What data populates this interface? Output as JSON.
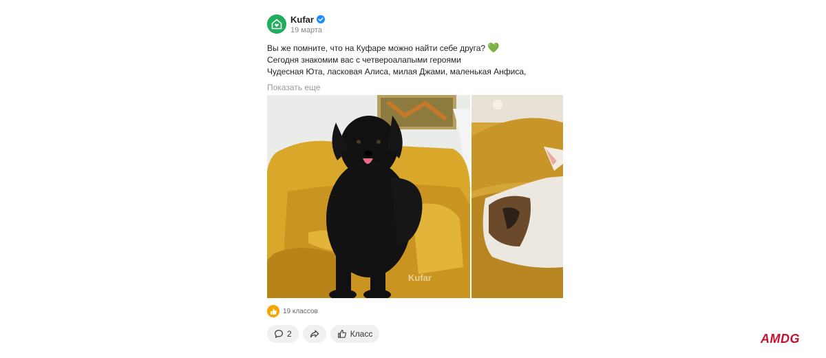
{
  "post": {
    "author": "Kufar",
    "date": "19 марта",
    "text_lines": [
      "Вы же помните, что на Куфаре можно найти себе друга?",
      "Сегодня знакомим вас с четвероалапыми героями",
      "Чудесная Юта, ласковая Алиса, милая Джами, маленькая Анфиса,"
    ],
    "heart_emoji": "💚",
    "show_more": "Показать еще",
    "photo_watermark": "Kufar"
  },
  "reactions": {
    "count_label": "19 классов"
  },
  "actions": {
    "comments_count": "2",
    "like_label": "Класс"
  },
  "brand": {
    "logo_text": "AMDG",
    "color": "#c8102e"
  },
  "colors": {
    "avatar_bg": "#1fae5d",
    "verified": "#1a8cff",
    "like_badge": "#f7a600"
  }
}
